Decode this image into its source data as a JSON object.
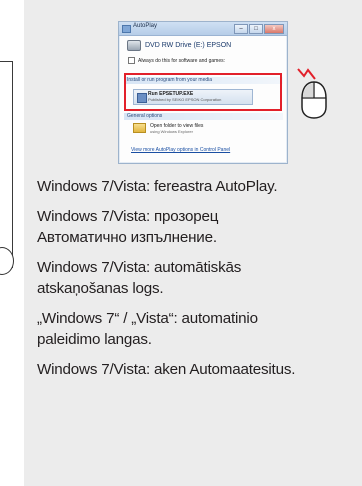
{
  "autoplay_window": {
    "title": "AutoPlay",
    "drive_label": "DVD RW Drive (E:) EPSON",
    "always_do_label": "Always do this for software and games:",
    "install_section": "Install or run program from your media",
    "run_item_title": "Run EPSETUP.EXE",
    "run_item_publisher": "Published by SEIKO EPSON Corporation",
    "general_section": "General options",
    "folder_title": "Open folder to view files",
    "folder_sub": "using Windows Explorer",
    "control_panel_link": "View more AutoPlay options in Control Panel",
    "buttons": {
      "minimize": "–",
      "maximize": "□",
      "close": "x"
    }
  },
  "captions": [
    {
      "lines": [
        "Windows 7/Vista: fereastra AutoPlay."
      ]
    },
    {
      "lines": [
        "Windows 7/Vista: прозорец",
        "Автоматично изпълнение."
      ]
    },
    {
      "lines": [
        "Windows 7/Vista: automātiskās",
        "atskaņošanas logs."
      ]
    },
    {
      "lines": [
        "„Windows 7“ / „Vista“: automatinio",
        "paleidimo langas."
      ]
    },
    {
      "lines": [
        "Windows 7/Vista: aken Automaatesitus."
      ]
    }
  ],
  "colors": {
    "panel_bg": "#ececec",
    "highlight_red": "#e2202a",
    "text": "#231f20"
  },
  "icons": [
    "drive-icon",
    "folder-icon",
    "mouse-icon",
    "click-mark-icon"
  ]
}
